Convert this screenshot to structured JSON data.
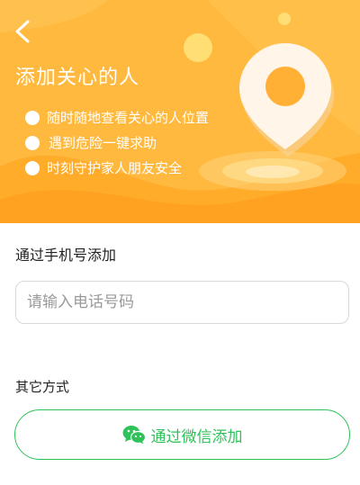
{
  "header": {
    "back_icon": "chevron-left-icon",
    "title": "添加关心的人"
  },
  "features": [
    "随时随地查看关心的人位置",
    "遇到危险一键求助",
    "时刻守护家人朋友安全"
  ],
  "colors": {
    "hero_orange": "#ffb93f",
    "accent_green": "#2fc25b",
    "white": "#ffffff"
  },
  "phone_section": {
    "label": "通过手机号添加",
    "input_value": "",
    "input_placeholder": "请输入电话号码"
  },
  "other_section": {
    "label": "其它方式",
    "wechat_button_label": "通过微信添加",
    "wechat_icon": "wechat-icon"
  }
}
